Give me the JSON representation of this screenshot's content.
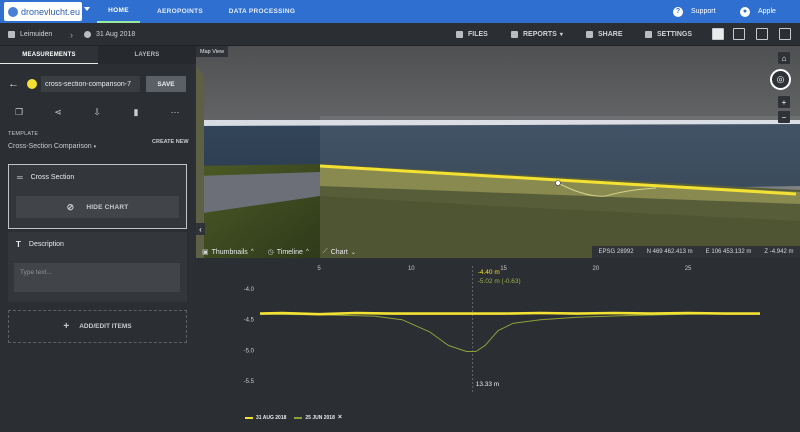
{
  "app": {
    "logo_text": "dronevlucht.eu"
  },
  "nav": {
    "tabs": [
      "HOME",
      "AEROPOINTS",
      "DATA PROCESSING"
    ],
    "support": "Support",
    "user": "Apple"
  },
  "toolbar": {
    "breadcrumb_site": "Leimuiden",
    "breadcrumb_date": "31 Aug 2018",
    "files": "FILES",
    "reports": "REPORTS",
    "share": "SHARE",
    "settings": "SETTINGS"
  },
  "sidebar": {
    "tabs": [
      "MEASUREMENTS",
      "LAYERS"
    ],
    "measurement_name": "cross-section-comparison-7",
    "save_label": "SAVE",
    "template_label": "TEMPLATE",
    "template_value": "Cross-Section Comparison",
    "create_new": "CREATE NEW",
    "cross_section_title": "Cross Section",
    "hide_chart_label": "HIDE CHART",
    "description_title": "Description",
    "description_placeholder": "Type text...",
    "add_items_label": "ADD/EDIT ITEMS",
    "accent_color": "#f3e233"
  },
  "map": {
    "label": "Map View",
    "epsg_label": "EPSG",
    "epsg": "28992",
    "n_label": "N",
    "n_value": "469 462.413 m",
    "e_label": "E",
    "e_value": "106 453.132 m",
    "z_label": "Z",
    "z_value": "-4.942 m"
  },
  "bottom_tabs": [
    "Thumbnails",
    "Timeline",
    "Chart"
  ],
  "chart_data": {
    "type": "line",
    "x_ticks": [
      5,
      10,
      15,
      20,
      25
    ],
    "y_ticks": [
      -4.0,
      -4.5,
      -5.0,
      -5.5
    ],
    "ylim": [
      -5.65,
      -3.85
    ],
    "xlim": [
      1.8,
      28.9
    ],
    "cursor": {
      "x": 13.33,
      "x_label": "13.33 m",
      "value_a": "-4.40 m",
      "value_b": "-5.02 m (-0.63)"
    },
    "series": [
      {
        "name": "31 AUG 2018",
        "color": "#f3e233",
        "points": [
          [
            1.8,
            -4.4
          ],
          [
            3,
            -4.39
          ],
          [
            5,
            -4.41
          ],
          [
            7,
            -4.39
          ],
          [
            9,
            -4.4
          ],
          [
            11,
            -4.4
          ],
          [
            13.3,
            -4.4
          ],
          [
            15,
            -4.4
          ],
          [
            17,
            -4.39
          ],
          [
            19,
            -4.4
          ],
          [
            21,
            -4.39
          ],
          [
            23,
            -4.4
          ],
          [
            25,
            -4.39
          ],
          [
            27,
            -4.4
          ],
          [
            28.9,
            -4.4
          ]
        ]
      },
      {
        "name": "25 JUN 2018",
        "color": "#8fa13a",
        "points": [
          [
            1.8,
            -4.41
          ],
          [
            5,
            -4.42
          ],
          [
            8,
            -4.44
          ],
          [
            9.5,
            -4.5
          ],
          [
            11,
            -4.7
          ],
          [
            12,
            -4.92
          ],
          [
            13,
            -5.02
          ],
          [
            13.5,
            -5.02
          ],
          [
            14,
            -4.92
          ],
          [
            14.7,
            -4.68
          ],
          [
            15.5,
            -4.56
          ],
          [
            17,
            -4.5
          ],
          [
            19,
            -4.46
          ],
          [
            22,
            -4.43
          ],
          [
            25,
            -4.41
          ],
          [
            28.9,
            -4.4
          ]
        ]
      }
    ]
  }
}
